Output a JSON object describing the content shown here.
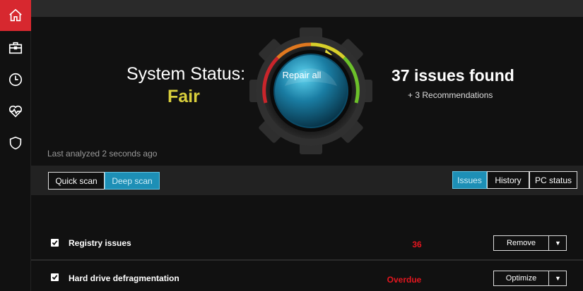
{
  "sidebar": {
    "items": [
      {
        "name": "home-icon",
        "active": true
      },
      {
        "name": "briefcase-icon",
        "active": false
      },
      {
        "name": "clock-icon",
        "active": false
      },
      {
        "name": "heartbeat-icon",
        "active": false
      },
      {
        "name": "shield-icon",
        "active": false
      }
    ]
  },
  "colors": {
    "accent_red": "#d7282f",
    "status_yellow": "#d9cf3c",
    "tab_blue": "#1d8fb6",
    "value_red": "#e4161f"
  },
  "hero": {
    "status_label": "System Status:",
    "status_value": "Fair",
    "repair_label": "Repair all",
    "issues_found": "37 issues found",
    "recommendations": "+ 3 Recommendations",
    "last_analyzed": "Last analyzed 2 seconds ago"
  },
  "scan": {
    "quick_label": "Quick scan",
    "deep_label": "Deep scan",
    "selected": "Deep scan"
  },
  "view_tabs": {
    "issues_label": "Issues",
    "history_label": "History",
    "pc_status_label": "PC status",
    "selected": "Issues"
  },
  "rows": [
    {
      "label": "Registry issues",
      "value": "36",
      "action": "Remove",
      "checked": true
    },
    {
      "label": "Hard drive defragmentation",
      "value": "Overdue",
      "action": "Optimize",
      "checked": true
    }
  ]
}
